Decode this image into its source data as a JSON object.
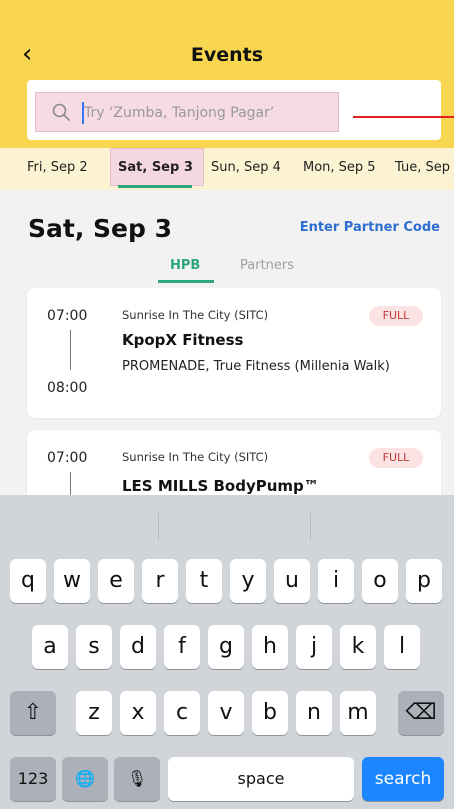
{
  "header": {
    "back_icon": "chevron-left-icon",
    "back_glyph": "‹",
    "title": "Events"
  },
  "search": {
    "placeholder": "Try ‘Zumba, Tanjong Pagar’",
    "value": ""
  },
  "date_tabs": [
    {
      "label": "Fri, Sep 2",
      "active": false
    },
    {
      "label": "Sat, Sep 3",
      "active": true
    },
    {
      "label": "Sun, Sep 4",
      "active": false
    },
    {
      "label": "Mon, Sep 5",
      "active": false
    },
    {
      "label": "Tue, Sep",
      "active": false
    }
  ],
  "day": {
    "title": "Sat, Sep 3",
    "partner_code_link": "Enter Partner Code",
    "segments": [
      "HPB",
      "Partners"
    ],
    "active_segment": "HPB"
  },
  "events": [
    {
      "start": "07:00",
      "end": "08:00",
      "organizer": "Sunrise In The City (SITC)",
      "name": "KpopX Fitness",
      "location": "PROMENADE, True Fitness (Millenia Walk)",
      "status": "FULL"
    },
    {
      "start": "07:00",
      "organizer": "Sunrise In The City (SITC)",
      "name": "LES MILLS BodyPump™",
      "status": "FULL"
    }
  ],
  "keyboard": {
    "row1": [
      "q",
      "w",
      "e",
      "r",
      "t",
      "y",
      "u",
      "i",
      "o",
      "p"
    ],
    "row2": [
      "a",
      "s",
      "d",
      "f",
      "g",
      "h",
      "j",
      "k",
      "l"
    ],
    "row3": [
      "z",
      "x",
      "c",
      "v",
      "b",
      "n",
      "m"
    ],
    "shift_glyph": "⇧",
    "delete_glyph": "⌫",
    "numbers_label": "123",
    "globe_glyph": "🌐",
    "mic_glyph": "🎙",
    "space_label": "space",
    "search_label": "search"
  },
  "colors": {
    "header": "#f9d64f",
    "accent_green": "#2fa77b",
    "link_blue": "#2f6ed1",
    "full_badge_bg": "#fbe3e3",
    "full_badge_text": "#c23838",
    "keyboard_search": "#1b86ff"
  }
}
